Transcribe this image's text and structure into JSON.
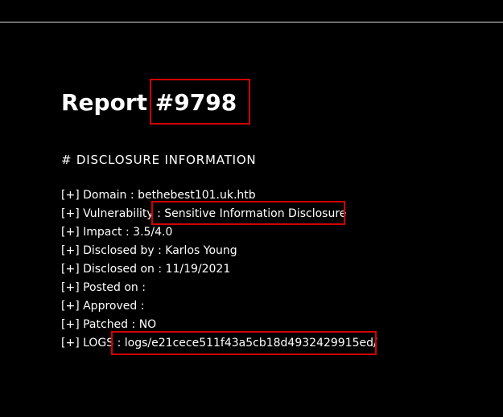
{
  "report": {
    "title_prefix": "Report",
    "id": "#9798"
  },
  "section": {
    "heading": "# DISCLOSURE INFORMATION"
  },
  "bullet": "[+]",
  "fields": [
    {
      "label": "Domain",
      "sep": " : ",
      "value": "bethebest101.uk.htb"
    },
    {
      "label": "Vulnerability",
      "sep": " : ",
      "value": "Sensitive Information Disclosure"
    },
    {
      "label": "Impact",
      "sep": " : ",
      "value": "3.5/4.0"
    },
    {
      "label": "Disclosed by",
      "sep": " : ",
      "value": "Karlos Young"
    },
    {
      "label": "Disclosed on",
      "sep": " : ",
      "value": "11/19/2021"
    },
    {
      "label": "Posted on",
      "sep": " : ",
      "value": ""
    },
    {
      "label": "Approved",
      "sep": " : ",
      "value": ""
    },
    {
      "label": "Patched",
      "sep": " : ",
      "value": "NO"
    },
    {
      "label": "LOGS",
      "sep": " : ",
      "value": "logs/e21cece511f43a5cb18d4932429915ed/"
    }
  ],
  "colors": {
    "background": "#000000",
    "text": "#ffffff",
    "highlight": "#d40000",
    "rule": "#d9d9d9"
  }
}
